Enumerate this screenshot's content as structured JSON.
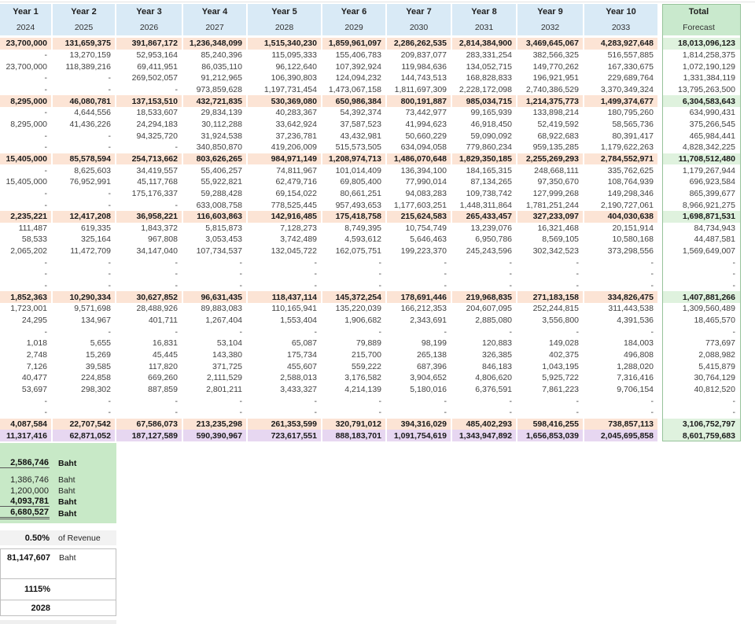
{
  "header": {
    "columns": [
      {
        "label": "Year 1",
        "year": "2024"
      },
      {
        "label": "Year 2",
        "year": "2025"
      },
      {
        "label": "Year 3",
        "year": "2026"
      },
      {
        "label": "Year 4",
        "year": "2027"
      },
      {
        "label": "Year 5",
        "year": "2028"
      },
      {
        "label": "Year 6",
        "year": "2029"
      },
      {
        "label": "Year 7",
        "year": "2030"
      },
      {
        "label": "Year 8",
        "year": "2031"
      },
      {
        "label": "Year 9",
        "year": "2032"
      },
      {
        "label": "Year 10",
        "year": "2033"
      }
    ],
    "total_label": "Total",
    "forecast_label": "Forecast"
  },
  "table": {
    "rows": [
      {
        "type": "subtotal",
        "cells": [
          "23,700,000",
          "131,659,375",
          "391,867,172",
          "1,236,348,099",
          "1,515,340,230",
          "1,859,961,097",
          "2,286,262,535",
          "2,814,384,900",
          "3,469,645,067",
          "4,283,927,648",
          "18,013,096,123"
        ]
      },
      {
        "type": "normal",
        "cells": [
          "-",
          "13,270,159",
          "52,953,164",
          "85,240,396",
          "115,095,333",
          "155,406,783",
          "209,837,077",
          "283,331,254",
          "382,566,325",
          "516,557,885",
          "1,814,258,375"
        ]
      },
      {
        "type": "normal",
        "cells": [
          "23,700,000",
          "118,389,216",
          "69,411,951",
          "86,035,110",
          "96,122,640",
          "107,392,924",
          "119,984,636",
          "134,052,715",
          "149,770,262",
          "167,330,675",
          "1,072,190,129"
        ]
      },
      {
        "type": "normal",
        "cells": [
          "-",
          "-",
          "269,502,057",
          "91,212,965",
          "106,390,803",
          "124,094,232",
          "144,743,513",
          "168,828,833",
          "196,921,951",
          "229,689,764",
          "1,331,384,119"
        ]
      },
      {
        "type": "normal",
        "cells": [
          "-",
          "-",
          "-",
          "973,859,628",
          "1,197,731,454",
          "1,473,067,158",
          "1,811,697,309",
          "2,228,172,098",
          "2,740,386,529",
          "3,370,349,324",
          "13,795,263,500"
        ]
      },
      {
        "type": "subtotal",
        "cells": [
          "8,295,000",
          "46,080,781",
          "137,153,510",
          "432,721,835",
          "530,369,080",
          "650,986,384",
          "800,191,887",
          "985,034,715",
          "1,214,375,773",
          "1,499,374,677",
          "6,304,583,643"
        ]
      },
      {
        "type": "normal",
        "cells": [
          "-",
          "4,644,556",
          "18,533,607",
          "29,834,139",
          "40,283,367",
          "54,392,374",
          "73,442,977",
          "99,165,939",
          "133,898,214",
          "180,795,260",
          "634,990,431"
        ]
      },
      {
        "type": "normal",
        "cells": [
          "8,295,000",
          "41,436,226",
          "24,294,183",
          "30,112,288",
          "33,642,924",
          "37,587,523",
          "41,994,623",
          "46,918,450",
          "52,419,592",
          "58,565,736",
          "375,266,545"
        ]
      },
      {
        "type": "normal",
        "cells": [
          "-",
          "-",
          "94,325,720",
          "31,924,538",
          "37,236,781",
          "43,432,981",
          "50,660,229",
          "59,090,092",
          "68,922,683",
          "80,391,417",
          "465,984,441"
        ]
      },
      {
        "type": "normal",
        "cells": [
          "-",
          "-",
          "-",
          "340,850,870",
          "419,206,009",
          "515,573,505",
          "634,094,058",
          "779,860,234",
          "959,135,285",
          "1,179,622,263",
          "4,828,342,225"
        ]
      },
      {
        "type": "subtotal",
        "cells": [
          "15,405,000",
          "85,578,594",
          "254,713,662",
          "803,626,265",
          "984,971,149",
          "1,208,974,713",
          "1,486,070,648",
          "1,829,350,185",
          "2,255,269,293",
          "2,784,552,971",
          "11,708,512,480"
        ]
      },
      {
        "type": "normal",
        "cells": [
          "-",
          "8,625,603",
          "34,419,557",
          "55,406,257",
          "74,811,967",
          "101,014,409",
          "136,394,100",
          "184,165,315",
          "248,668,111",
          "335,762,625",
          "1,179,267,944"
        ]
      },
      {
        "type": "normal",
        "cells": [
          "15,405,000",
          "76,952,991",
          "45,117,768",
          "55,922,821",
          "62,479,716",
          "69,805,400",
          "77,990,014",
          "87,134,265",
          "97,350,670",
          "108,764,939",
          "696,923,584"
        ]
      },
      {
        "type": "normal",
        "cells": [
          "-",
          "-",
          "175,176,337",
          "59,288,428",
          "69,154,022",
          "80,661,251",
          "94,083,283",
          "109,738,742",
          "127,999,268",
          "149,298,346",
          "865,399,677"
        ]
      },
      {
        "type": "normal",
        "cells": [
          "-",
          "-",
          "-",
          "633,008,758",
          "778,525,445",
          "957,493,653",
          "1,177,603,251",
          "1,448,311,864",
          "1,781,251,244",
          "2,190,727,061",
          "8,966,921,275"
        ]
      },
      {
        "type": "subtotal",
        "cells": [
          "2,235,221",
          "12,417,208",
          "36,958,221",
          "116,603,863",
          "142,916,485",
          "175,418,758",
          "215,624,583",
          "265,433,457",
          "327,233,097",
          "404,030,638",
          "1,698,871,531"
        ]
      },
      {
        "type": "normal",
        "cells": [
          "111,487",
          "619,335",
          "1,843,372",
          "5,815,873",
          "7,128,273",
          "8,749,395",
          "10,754,749",
          "13,239,076",
          "16,321,468",
          "20,151,914",
          "84,734,943"
        ]
      },
      {
        "type": "normal",
        "cells": [
          "58,533",
          "325,164",
          "967,808",
          "3,053,453",
          "3,742,489",
          "4,593,612",
          "5,646,463",
          "6,950,786",
          "8,569,105",
          "10,580,168",
          "44,487,581"
        ]
      },
      {
        "type": "normal",
        "cells": [
          "2,065,202",
          "11,472,709",
          "34,147,040",
          "107,734,537",
          "132,045,722",
          "162,075,751",
          "199,223,370",
          "245,243,596",
          "302,342,523",
          "373,298,556",
          "1,569,649,007"
        ]
      },
      {
        "type": "dash",
        "cells": [
          "-",
          "-",
          "-",
          "-",
          "-",
          "-",
          "-",
          "-",
          "-",
          "-",
          "-"
        ]
      },
      {
        "type": "dash",
        "cells": [
          "-",
          "-",
          "-",
          "-",
          "-",
          "-",
          "-",
          "-",
          "-",
          "-",
          "-"
        ]
      },
      {
        "type": "dash",
        "cells": [
          "-",
          "-",
          "-",
          "-",
          "-",
          "-",
          "-",
          "-",
          "-",
          "-",
          "-"
        ]
      },
      {
        "type": "subtotal",
        "cells": [
          "1,852,363",
          "10,290,334",
          "30,627,852",
          "96,631,435",
          "118,437,114",
          "145,372,254",
          "178,691,446",
          "219,968,835",
          "271,183,158",
          "334,826,475",
          "1,407,881,266"
        ]
      },
      {
        "type": "normal",
        "cells": [
          "1,723,001",
          "9,571,698",
          "28,488,926",
          "89,883,083",
          "110,165,941",
          "135,220,039",
          "166,212,353",
          "204,607,095",
          "252,244,815",
          "311,443,538",
          "1,309,560,489"
        ]
      },
      {
        "type": "normal",
        "cells": [
          "24,295",
          "134,967",
          "401,711",
          "1,267,404",
          "1,553,404",
          "1,906,682",
          "2,343,691",
          "2,885,080",
          "3,556,800",
          "4,391,536",
          "18,465,570"
        ]
      },
      {
        "type": "dash",
        "cells": [
          "-",
          "-",
          "-",
          "-",
          "-",
          "-",
          "-",
          "-",
          "-",
          "-",
          "-"
        ]
      },
      {
        "type": "normal",
        "cells": [
          "1,018",
          "5,655",
          "16,831",
          "53,104",
          "65,087",
          "79,889",
          "98,199",
          "120,883",
          "149,028",
          "184,003",
          "773,697"
        ]
      },
      {
        "type": "normal",
        "cells": [
          "2,748",
          "15,269",
          "45,445",
          "143,380",
          "175,734",
          "215,700",
          "265,138",
          "326,385",
          "402,375",
          "496,808",
          "2,088,982"
        ]
      },
      {
        "type": "normal",
        "cells": [
          "7,126",
          "39,585",
          "117,820",
          "371,725",
          "455,607",
          "559,222",
          "687,396",
          "846,183",
          "1,043,195",
          "1,288,020",
          "5,415,879"
        ]
      },
      {
        "type": "normal",
        "cells": [
          "40,477",
          "224,858",
          "669,260",
          "2,111,529",
          "2,588,013",
          "3,176,582",
          "3,904,652",
          "4,806,620",
          "5,925,722",
          "7,316,416",
          "30,764,129"
        ]
      },
      {
        "type": "normal",
        "cells": [
          "53,697",
          "298,302",
          "887,859",
          "2,801,211",
          "3,433,327",
          "4,214,139",
          "5,180,016",
          "6,376,591",
          "7,861,223",
          "9,706,154",
          "40,812,520"
        ]
      },
      {
        "type": "dash",
        "cells": [
          "-",
          "-",
          "-",
          "-",
          "-",
          "-",
          "-",
          "-",
          "-",
          "-",
          "-"
        ]
      },
      {
        "type": "dash",
        "cells": [
          "-",
          "-",
          "-",
          "-",
          "-",
          "-",
          "-",
          "-",
          "-",
          "-",
          "-"
        ]
      },
      {
        "type": "subtotal",
        "cells": [
          "4,087,584",
          "22,707,542",
          "67,586,073",
          "213,235,298",
          "261,353,599",
          "320,791,012",
          "394,316,029",
          "485,402,293",
          "598,416,255",
          "738,857,113",
          "3,106,752,797"
        ]
      },
      {
        "type": "grand",
        "cells": [
          "11,317,416",
          "62,871,052",
          "187,127,589",
          "590,390,967",
          "723,617,551",
          "888,183,701",
          "1,091,754,619",
          "1,343,947,892",
          "1,656,853,039",
          "2,045,695,858",
          "8,601,759,683"
        ]
      }
    ]
  },
  "summary": {
    "green": [
      {
        "value": "2,586,746",
        "unit": "Baht"
      },
      {
        "value": "1,386,746",
        "unit": "Baht"
      },
      {
        "value": "1,200,000",
        "unit": "Baht"
      },
      {
        "value": "4,093,781",
        "unit": "Baht"
      },
      {
        "value": "6,680,527",
        "unit": "Baht"
      }
    ],
    "percent": {
      "value": "0.50%",
      "label": "of Revenue"
    },
    "box": {
      "amount": "81,147,607",
      "amount_unit": "Baht",
      "ratio": "1115%",
      "year": "2028"
    }
  },
  "colors": {
    "header_blue": "#D9EAF6",
    "subtotal_peach": "#FCE4D5",
    "grand_purple": "#E7D7F1",
    "total_header_green": "#C9E9CD",
    "total_value_green": "#DFF2DE",
    "summary_green": "#C8E9C7",
    "percent_gray": "#F2F2F2",
    "total_outline_green": "#97C39B"
  }
}
